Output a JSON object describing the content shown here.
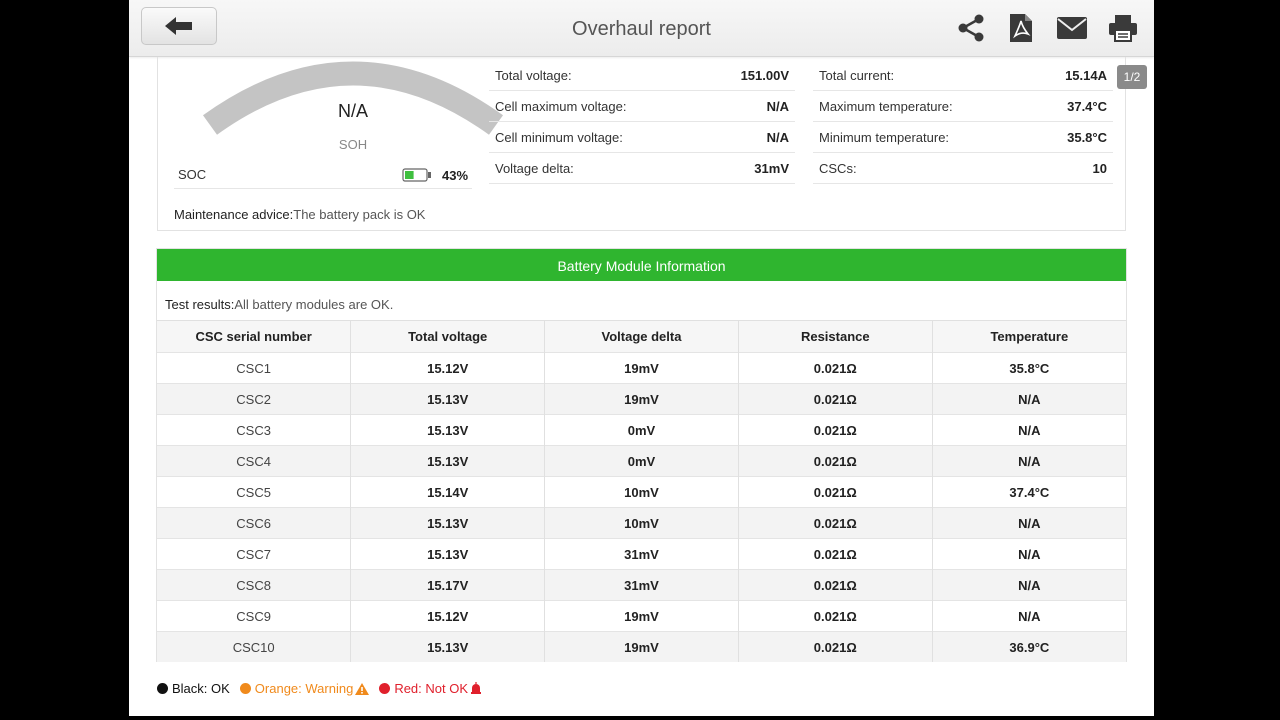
{
  "header": {
    "title": "Overhaul report",
    "icons": [
      "back-arrow-icon",
      "share-icon",
      "pdf-icon",
      "mail-icon",
      "print-icon"
    ]
  },
  "page_indicator": "1/2",
  "summary": {
    "soh_value": "N/A",
    "soh_label": "SOH",
    "soc_label": "SOC",
    "soc_value": "43%",
    "soc_fraction": 0.43,
    "advice_label": "Maintenance advice:",
    "advice_value": "The battery pack is OK",
    "left_stats": [
      {
        "label": "Total voltage:",
        "value": "151.00V"
      },
      {
        "label": "Cell maximum voltage:",
        "value": "N/A"
      },
      {
        "label": "Cell minimum voltage:",
        "value": "N/A"
      },
      {
        "label": "Voltage delta:",
        "value": "31mV"
      }
    ],
    "right_stats": [
      {
        "label": "Total current:",
        "value": "15.14A"
      },
      {
        "label": "Maximum temperature:",
        "value": "37.4°C"
      },
      {
        "label": "Minimum temperature:",
        "value": "35.8°C"
      },
      {
        "label": "CSCs:",
        "value": "10"
      }
    ]
  },
  "module": {
    "title": "Battery Module Information",
    "test_label": "Test results:",
    "test_value": "All battery modules are OK.",
    "columns": [
      "CSC serial number",
      "Total voltage",
      "Voltage delta",
      "Resistance",
      "Temperature"
    ],
    "rows": [
      [
        "CSC1",
        "15.12V",
        "19mV",
        "0.021Ω",
        "35.8°C"
      ],
      [
        "CSC2",
        "15.13V",
        "19mV",
        "0.021Ω",
        "N/A"
      ],
      [
        "CSC3",
        "15.13V",
        "0mV",
        "0.021Ω",
        "N/A"
      ],
      [
        "CSC4",
        "15.13V",
        "0mV",
        "0.021Ω",
        "N/A"
      ],
      [
        "CSC5",
        "15.14V",
        "10mV",
        "0.021Ω",
        "37.4°C"
      ],
      [
        "CSC6",
        "15.13V",
        "10mV",
        "0.021Ω",
        "N/A"
      ],
      [
        "CSC7",
        "15.13V",
        "31mV",
        "0.021Ω",
        "N/A"
      ],
      [
        "CSC8",
        "15.17V",
        "31mV",
        "0.021Ω",
        "N/A"
      ],
      [
        "CSC9",
        "15.12V",
        "19mV",
        "0.021Ω",
        "N/A"
      ],
      [
        "CSC10",
        "15.13V",
        "19mV",
        "0.021Ω",
        "36.9°C"
      ]
    ]
  },
  "legend": [
    {
      "label": "Black: OK",
      "color": "#111111"
    },
    {
      "label": "Orange: Warning",
      "color": "#f08a1c"
    },
    {
      "label": "Red: Not OK",
      "color": "#e0202c"
    }
  ],
  "colors": {
    "accent_green": "#2fb52f",
    "battery_green": "#3fbf3f"
  }
}
